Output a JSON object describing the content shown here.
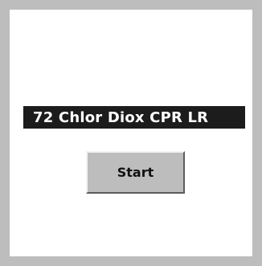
{
  "panel": {
    "title": "72 Chlor Diox CPR LR",
    "start_label": "Start"
  },
  "colors": {
    "frame": "#bdbdbd",
    "panel_background": "#ffffff",
    "title_bar": "#1c1c1c",
    "title_text": "#ffffff",
    "button_face": "#bdbdbd"
  }
}
